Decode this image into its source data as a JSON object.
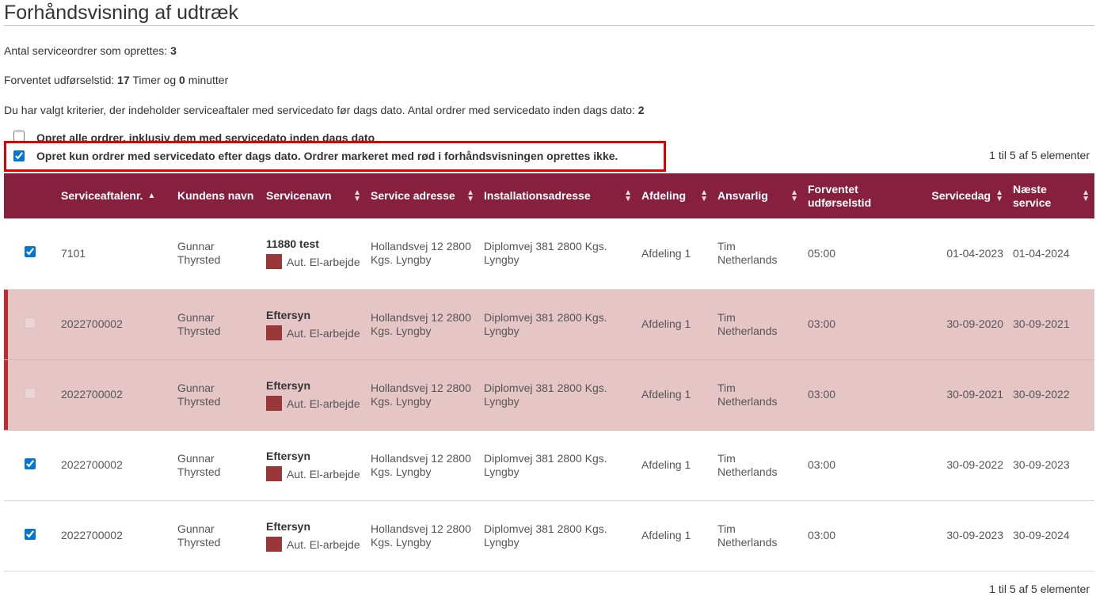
{
  "page": {
    "title": "Forhåndsvisning af udtræk"
  },
  "info": {
    "orders_label": "Antal serviceordrer som oprettes:",
    "orders_value": "3",
    "time_label": "Forventet udførselstid:",
    "time_hours": "17",
    "time_hours_unit": "Timer og",
    "time_minutes": "0",
    "time_minutes_unit": "minutter",
    "criteria_text": "Du har valgt kriterier, der indeholder serviceaftaler med servicedato før dags dato. Antal ordrer med servicedato inden dags dato:",
    "criteria_value": "2"
  },
  "options": {
    "all_label": "Opret alle ordrer, inklusiv dem med servicedato inden dags dato",
    "all_checked": false,
    "future_label": "Opret kun ordrer med servicedato efter dags dato. Ordrer markeret med rød i forhåndsvisningen oprettes ikke.",
    "future_checked": true
  },
  "pager": {
    "summary": "1 til 5 af 5 elementer"
  },
  "colors": {
    "header_bg": "#87203f",
    "excluded_row_bg": "#e6c5c7",
    "excluded_row_marker": "#c5282f",
    "service_swatch": "#9a3738",
    "highlight_border": "#e00000"
  },
  "table": {
    "columns": [
      {
        "key": "select",
        "label": ""
      },
      {
        "key": "agreement_no",
        "label": "Serviceaftalenr.",
        "sort": "asc"
      },
      {
        "key": "customer",
        "label": "Kundens navn"
      },
      {
        "key": "service_name",
        "label": "Servicenavn",
        "sort": "both"
      },
      {
        "key": "service_address",
        "label": "Service adresse",
        "sort": "both"
      },
      {
        "key": "install_address",
        "label": "Installationsadresse",
        "sort": "both"
      },
      {
        "key": "department",
        "label": "Afdeling",
        "sort": "both"
      },
      {
        "key": "responsible",
        "label": "Ansvarlig",
        "sort": "both"
      },
      {
        "key": "expected_time",
        "label": "Forventet udførselstid"
      },
      {
        "key": "service_day",
        "label": "Servicedag",
        "sort": "both"
      },
      {
        "key": "next_service",
        "label": "Næste service",
        "sort": "both"
      }
    ],
    "rows": [
      {
        "checked": true,
        "excluded": false,
        "agreement_no": "7101",
        "customer": "Gunnar Thyrsted",
        "service_name": "11880 test",
        "service_type": "Aut. El-arbejde",
        "service_address": "Hollandsvej 12 2800 Kgs. Lyngby",
        "install_address": "Diplomvej 381 2800 Kgs. Lyngby",
        "department": "Afdeling 1",
        "responsible": "Tim Netherlands",
        "expected_time": "05:00",
        "service_day": "01-04-2023",
        "next_service": "01-04-2024"
      },
      {
        "checked": false,
        "excluded": true,
        "agreement_no": "2022700002",
        "customer": "Gunnar Thyrsted",
        "service_name": "Eftersyn",
        "service_type": "Aut. El-arbejde",
        "service_address": "Hollandsvej 12 2800 Kgs. Lyngby",
        "install_address": "Diplomvej 381 2800 Kgs. Lyngby",
        "department": "Afdeling 1",
        "responsible": "Tim Netherlands",
        "expected_time": "03:00",
        "service_day": "30-09-2020",
        "next_service": "30-09-2021"
      },
      {
        "checked": false,
        "excluded": true,
        "agreement_no": "2022700002",
        "customer": "Gunnar Thyrsted",
        "service_name": "Eftersyn",
        "service_type": "Aut. El-arbejde",
        "service_address": "Hollandsvej 12 2800 Kgs. Lyngby",
        "install_address": "Diplomvej 381 2800 Kgs. Lyngby",
        "department": "Afdeling 1",
        "responsible": "Tim Netherlands",
        "expected_time": "03:00",
        "service_day": "30-09-2021",
        "next_service": "30-09-2022"
      },
      {
        "checked": true,
        "excluded": false,
        "agreement_no": "2022700002",
        "customer": "Gunnar Thyrsted",
        "service_name": "Eftersyn",
        "service_type": "Aut. El-arbejde",
        "service_address": "Hollandsvej 12 2800 Kgs. Lyngby",
        "install_address": "Diplomvej 381 2800 Kgs. Lyngby",
        "department": "Afdeling 1",
        "responsible": "Tim Netherlands",
        "expected_time": "03:00",
        "service_day": "30-09-2022",
        "next_service": "30-09-2023"
      },
      {
        "checked": true,
        "excluded": false,
        "agreement_no": "2022700002",
        "customer": "Gunnar Thyrsted",
        "service_name": "Eftersyn",
        "service_type": "Aut. El-arbejde",
        "service_address": "Hollandsvej 12 2800 Kgs. Lyngby",
        "install_address": "Diplomvej 381 2800 Kgs. Lyngby",
        "department": "Afdeling 1",
        "responsible": "Tim Netherlands",
        "expected_time": "03:00",
        "service_day": "30-09-2023",
        "next_service": "30-09-2024"
      }
    ]
  }
}
